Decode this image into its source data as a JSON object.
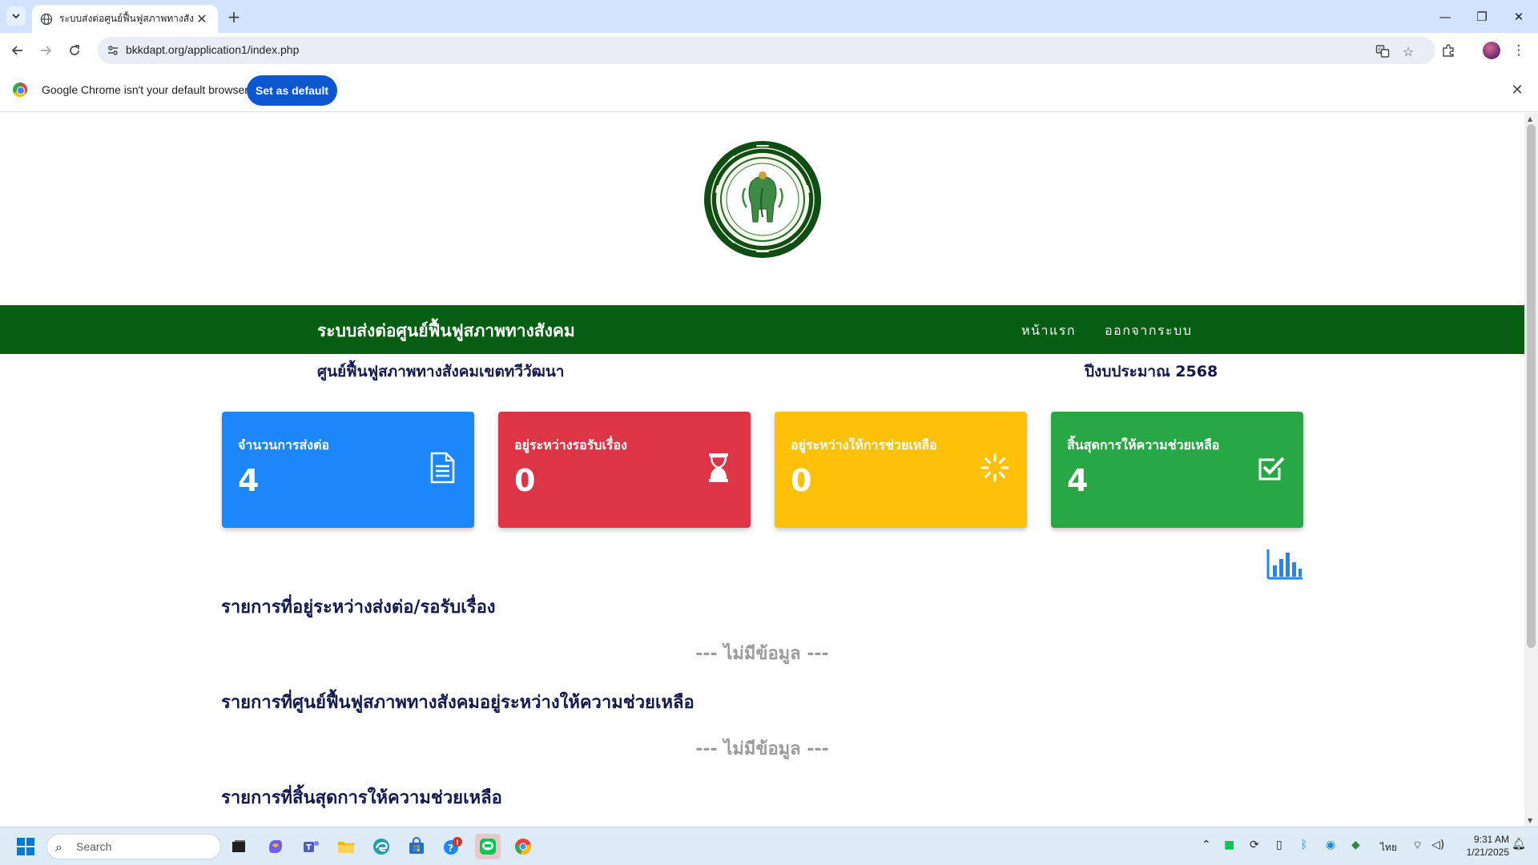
{
  "browser": {
    "tab_title": "ระบบส่งต่อศูนย์ฟื้นฟูสภาพทางสังคม",
    "url": "bkkdapt.org/application1/index.php",
    "infobar_text": "Google Chrome isn't your default browser",
    "set_default_label": "Set as default"
  },
  "page": {
    "brand": "ระบบส่งต่อศูนย์ฟื้นฟูสภาพทางสังคม",
    "nav": {
      "home": "หน้าแรก",
      "logout": "ออกจากระบบ"
    },
    "center_name": "ศูนย์ฟื้นฟูสภาพทางสังคมเขตทวีวัฒนา",
    "fiscal_year": "ปีงบประมาณ 2568",
    "cards": [
      {
        "label": "จำนวนการส่งต่อ",
        "value": "4",
        "color": "#1b87fa",
        "icon": "document-icon"
      },
      {
        "label": "อยู่ระหว่างรอรับเรื่อง",
        "value": "0",
        "color": "#dc3545",
        "icon": "hourglass-icon"
      },
      {
        "label": "อยู่ระหว่างให้การช่วยเหลือ",
        "value": "0",
        "color": "#ffc107",
        "icon": "spinner-icon"
      },
      {
        "label": "สิ้นสุดการให้ความช่วยเหลือ",
        "value": "4",
        "color": "#28a745",
        "icon": "checkbox-icon"
      }
    ],
    "sections": [
      {
        "title": "รายการที่อยู่ระหว่างส่งต่อ/รอรับเรื่อง",
        "empty": "--- ไม่มีข้อมูล ---"
      },
      {
        "title": "รายการที่ศูนย์ฟื้นฟูสภาพทางสังคมอยู่ระหว่างให้ความช่วยเหลือ",
        "empty": "--- ไม่มีข้อมูล ---"
      },
      {
        "title": "รายการที่สิ้นสุดการให้ความช่วยเหลือ"
      }
    ]
  },
  "taskbar": {
    "search_placeholder": "Search",
    "language": "ไทย",
    "time": "9:31 AM",
    "date": "1/21/2025",
    "notification_badge": "!"
  }
}
